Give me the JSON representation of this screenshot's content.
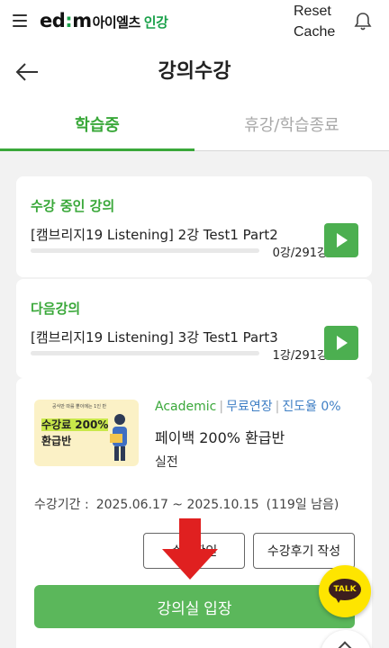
{
  "topbar": {
    "logo_ed": "ed",
    "logo_sep": ":",
    "logo_m": "m",
    "logo_kr": "아이엘츠",
    "logo_online": "인강",
    "reset_label": "Reset Cache",
    "icons": [
      "menu-icon",
      "bell-icon"
    ]
  },
  "header": {
    "title": "강의수강"
  },
  "tabs": [
    {
      "label": "학습중",
      "active": true
    },
    {
      "label": "휴강/학습종료",
      "active": false
    }
  ],
  "current": {
    "label": "수강 중인 강의",
    "lecture": "[캠브리지19 Listening] 2강 Test1 Part2",
    "progress": "0강/291강",
    "progress_fraction": 0
  },
  "next": {
    "label": "다음강의",
    "lecture": "[캠브리지19 Listening] 3강 Test1 Part3",
    "progress": "1강/291강",
    "progress_fraction": 0.0034
  },
  "course": {
    "thumb_small": "공식만 따를 뿐이에는 1인 반",
    "thumb_line1": "수강료 200%",
    "thumb_line2": "환급반",
    "tag_academic": "Academic",
    "tag_free": "무료연장",
    "tag_progress": "진도율 0%",
    "name": "페이백 200% 환급반",
    "level": "실전",
    "period_label": "수강기간 :",
    "period_dates": "2025.06.17 ~ 2025.10.15",
    "period_left": "(119일 남음)",
    "btn_confirm": "수강확인",
    "btn_review": "수강후기 작성",
    "btn_enter": "강의실 입장"
  },
  "floating": {
    "talk_label": "TALK"
  },
  "colors": {
    "accent_green": "#3aa83a",
    "button_green": "#5bb75b",
    "link_blue": "#3f7fc5",
    "arrow_red": "#e02020",
    "kakao_yellow": "#fee500"
  }
}
